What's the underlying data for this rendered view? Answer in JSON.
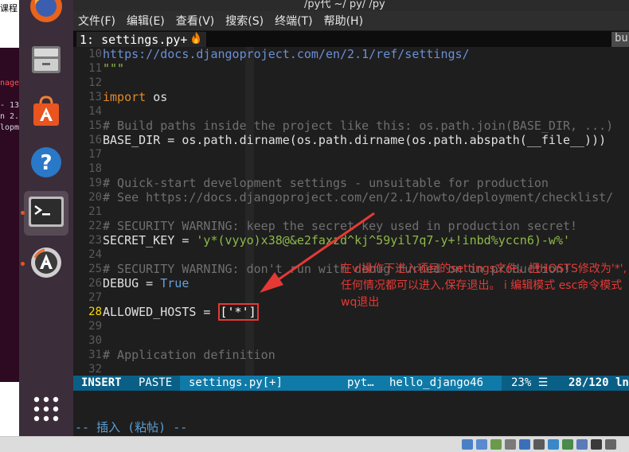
{
  "window": {
    "title": "/py代 ~/ py/ /py"
  },
  "menubar": [
    "文件(F)",
    "编辑(E)",
    "查看(V)",
    "搜索(S)",
    "终端(T)",
    "帮助(H)"
  ],
  "tab": {
    "label": "1: settings.py+",
    "right_label": "bu"
  },
  "lines": [
    {
      "n": "10",
      "parts": [
        {
          "t": "https://docs.djangoproject.com/en/2.1/ref/settings/",
          "c": "c-url"
        }
      ]
    },
    {
      "n": "11",
      "parts": [
        {
          "t": "\"\"\"",
          "c": "c-str"
        }
      ]
    },
    {
      "n": "12",
      "parts": []
    },
    {
      "n": "13",
      "parts": [
        {
          "t": "import",
          "c": "c-kw"
        },
        {
          "t": " os",
          "c": "c-plain"
        }
      ]
    },
    {
      "n": "14",
      "parts": []
    },
    {
      "n": "15",
      "parts": [
        {
          "t": "# Build paths inside the project like this: os.path.join(BASE_DIR, ...)",
          "c": "c-cmt"
        }
      ]
    },
    {
      "n": "16",
      "parts": [
        {
          "t": "BASE_DIR = os.path.dirname(os.path.dirname(os.path.abspath(__file__)))",
          "c": "c-plain"
        }
      ]
    },
    {
      "n": "17",
      "parts": []
    },
    {
      "n": "18",
      "parts": []
    },
    {
      "n": "19",
      "parts": [
        {
          "t": "# Quick-start development settings - unsuitable for production",
          "c": "c-cmt"
        }
      ]
    },
    {
      "n": "20",
      "parts": [
        {
          "t": "# See https://docs.djangoproject.com/en/2.1/howto/deployment/checklist/",
          "c": "c-cmt"
        }
      ]
    },
    {
      "n": "21",
      "parts": []
    },
    {
      "n": "22",
      "parts": [
        {
          "t": "# SECURITY WARNING: keep the secret key used in production secret!",
          "c": "c-cmt"
        }
      ]
    },
    {
      "n": "23",
      "parts": [
        {
          "t": "SECRET_KEY = ",
          "c": "c-plain"
        },
        {
          "t": "'y*(vyyo)x38@&e2faxzd^kj^59yil7q7-y+!inbd%yccn6)-w%'",
          "c": "c-str"
        }
      ]
    },
    {
      "n": "24",
      "parts": []
    },
    {
      "n": "25",
      "parts": [
        {
          "t": "# SECURITY WARNING: don't run with debug turned on in production!",
          "c": "c-cmt"
        }
      ]
    },
    {
      "n": "26",
      "parts": [
        {
          "t": "DEBUG = ",
          "c": "c-plain"
        },
        {
          "t": "True",
          "c": "c-const"
        }
      ]
    },
    {
      "n": "27",
      "parts": []
    },
    {
      "n": "28",
      "parts": [
        {
          "t": "ALLOWED_HOSTS = ",
          "c": "c-plain"
        },
        {
          "t": "['*']",
          "c": "c-br"
        }
      ],
      "current": true
    },
    {
      "n": "29",
      "parts": []
    },
    {
      "n": "30",
      "parts": []
    },
    {
      "n": "31",
      "parts": [
        {
          "t": "# Application definition",
          "c": "c-cmt"
        }
      ]
    },
    {
      "n": "32",
      "parts": []
    }
  ],
  "status": {
    "mode": "INSERT",
    "paste": "PASTE",
    "file": "settings.py[+]",
    "filetype": "pyt…",
    "project": "hello_django46",
    "percent": "23% ☰",
    "position": "28/120 ln"
  },
  "cmdline": "-- 插入 (粘帖) --",
  "annotation": {
    "text": "在vi操作下进入项目的settings文件，把HOSTS修改为'*',任何情况都可以进入,保存退出。 i 编辑模式 esc命令模式 wq退出",
    "color": "#e53935"
  },
  "launcher_icons": [
    "firefox-icon",
    "files-icon",
    "software-center-icon",
    "help-icon",
    "terminal-icon",
    "software-updater-icon",
    "app-grid-icon"
  ],
  "bg_fragments": [
    "课程",
    "nage",
    "- 13",
    "n 2.1",
    "lopme"
  ]
}
